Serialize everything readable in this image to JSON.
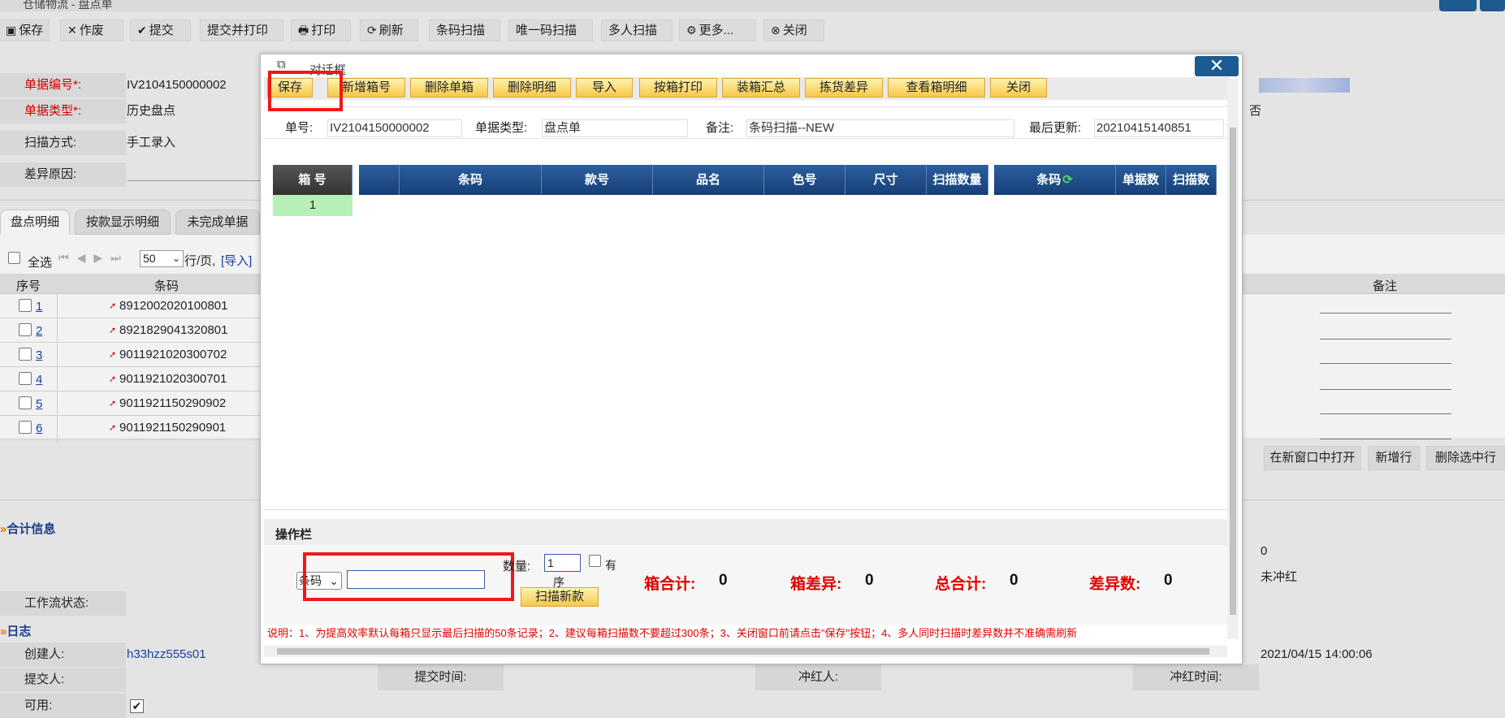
{
  "window": {
    "title": "仓储物流 - 盘点单"
  },
  "toolbar": {
    "save": "保存",
    "void": "作废",
    "submit": "提交",
    "submit_print": "提交并打印",
    "print": "打印",
    "refresh": "刷新",
    "barcode_scan": "条码扫描",
    "unique_scan": "唯一码扫描",
    "multi_scan": "多人扫描",
    "more": "更多...",
    "close": "关闭"
  },
  "form": {
    "doc_no_label": "单据编号*:",
    "doc_no": "IV2104150000002",
    "doc_type_label": "单据类型*:",
    "doc_type": "历史盘点",
    "scan_mode_label": "扫描方式:",
    "scan_mode": "手工录入",
    "diff_reason_label": "差异原因:",
    "right_value": "否"
  },
  "tabs": [
    "盘点明细",
    "按款显示明细",
    "未完成单据"
  ],
  "list_controls": {
    "select_all": "全选",
    "page_size": "50",
    "per_page": "行/页,",
    "import_link": "[导入]"
  },
  "grid": {
    "headers": {
      "seq": "序号",
      "barcode": "条码",
      "remark": "备注"
    },
    "rows": [
      {
        "num": "1",
        "barcode": "8912002020100801"
      },
      {
        "num": "2",
        "barcode": "8921829041320801"
      },
      {
        "num": "3",
        "barcode": "9011921020300702"
      },
      {
        "num": "4",
        "barcode": "9011921020300701"
      },
      {
        "num": "5",
        "barcode": "9011921150290902"
      },
      {
        "num": "6",
        "barcode": "9011921150290901"
      }
    ]
  },
  "right_actions": {
    "open_new": "在新窗口中打开",
    "add_row": "新增行",
    "delete_rows": "删除选中行"
  },
  "summary": {
    "title": "合计信息",
    "value_zero": "0",
    "red_status": "未冲红",
    "workflow_label": "工作流状态:"
  },
  "log": {
    "title": "日志",
    "creator_label": "创建人:",
    "creator": "h33hzz555s01",
    "submitter_label": "提交人:",
    "submit_time_label": "提交时间:",
    "reverser_label": "冲红人:",
    "reverse_time_label": "冲红时间:",
    "created_time": "2021/04/15 14:00:06",
    "enabled_label": "可用:"
  },
  "dialog": {
    "title": "对话框",
    "close_icon": "✕",
    "buttons": [
      "保存",
      "新增箱号",
      "删除单箱",
      "删除明细",
      "导入",
      "按箱打印",
      "装箱汇总",
      "拣货差异",
      "查看箱明细",
      "关闭"
    ],
    "fields": {
      "doc_no_label": "单号:",
      "doc_no": "IV2104150000002",
      "doc_type_label": "单据类型:",
      "doc_type": "盘点单",
      "remark_label": "备注:",
      "remark": "条码扫描--NEW",
      "updated_label": "最后更新:",
      "updated": "20210415140851"
    },
    "table": {
      "box_header": "箱 号",
      "box_first": "1",
      "headers": [
        "条码",
        "款号",
        "品名",
        "色号",
        "尺寸",
        "扫描数量"
      ],
      "right_headers": [
        "条码",
        "单据数",
        "扫描数"
      ]
    },
    "ops": {
      "title": "操作栏",
      "mode": "条码",
      "qty_label": "数量:",
      "qty": "1",
      "has_label": "有",
      "seq_label": "序",
      "scan_new": "扫描新款",
      "box_total_label": "箱合计:",
      "box_total": "0",
      "box_diff_label": "箱差异:",
      "box_diff": "0",
      "total_label": "总合计:",
      "total": "0",
      "diff_label": "差异数:",
      "diff": "0"
    },
    "note": "说明：1、为提高效率默认每箱只显示最后扫描的50条记录；2、建议每箱扫描数不要超过300条；3、关闭窗口前请点击\"保存\"按钮；4、多人同时扫描时差异数并不准确需刷新"
  }
}
